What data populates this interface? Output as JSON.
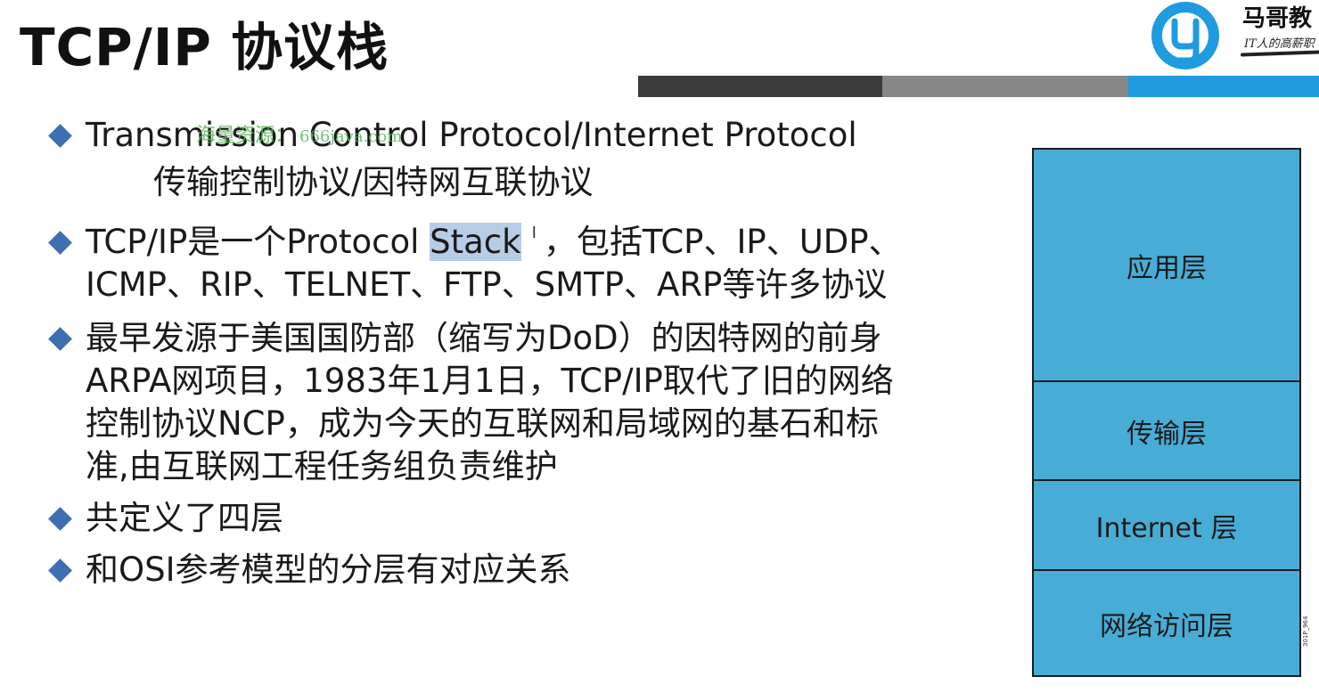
{
  "slide": {
    "title": "TCP/IP 协议栈"
  },
  "logo": {
    "name": "马哥教",
    "slogan": "IT人的高薪职"
  },
  "watermark": {
    "text": "海量资源：",
    "domain": "666java.com"
  },
  "bullets": [
    {
      "lines": [
        "Transmission Control Protocol/Internet Protocol"
      ],
      "sub": "传输控制协议/因特网互联协议"
    },
    {
      "prefix": "TCP/IP是一个Protocol ",
      "highlighted": "Stack",
      "suffix": "，包括TCP、IP、UDP、",
      "line2": "ICMP、RIP、TELNET、FTP、SMTP、ARP等许多协议"
    },
    {
      "lines": [
        "最早发源于美国国防部（缩写为DoD）的因特网的前身",
        "ARPA网项目，1983年1月1日，TCP/IP取代了旧的网络",
        "控制协议NCP，成为今天的互联网和局域网的基石和标",
        "准,由互联网工程任务组负责维护"
      ]
    },
    {
      "lines": [
        "共定义了四层"
      ]
    },
    {
      "lines": [
        "和OSI参考模型的分层有对应关系"
      ]
    }
  ],
  "cursor_glyph": "I",
  "layers": {
    "application": "应用层",
    "transport": "传输层",
    "internet": "Internet 层",
    "network_access": "网络访问层"
  },
  "figure_id": "301P_964",
  "colors": {
    "bar_dark": "#3c3c3c",
    "bar_gray": "#878787",
    "bar_blue": "#1f9be0",
    "layer_fill": "#48add6",
    "bullet_diamond": "#3f6fb3",
    "highlight": "#b7cde6"
  }
}
